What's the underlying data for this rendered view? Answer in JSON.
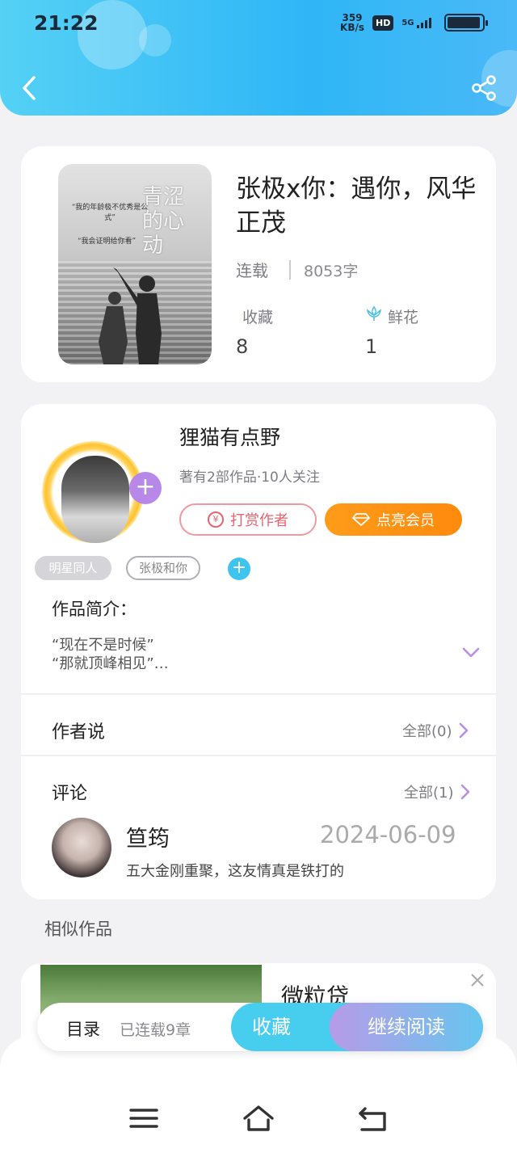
{
  "status_bar": {
    "time": "21:22",
    "net_speed_value": "359",
    "net_speed_unit": "KB/s",
    "hd": "HD",
    "signal": "5G",
    "battery_level": 0.95
  },
  "book": {
    "title": "张极x你：遇你，风华正茂",
    "status": "连载",
    "word_count": "8053字",
    "collect_label": "收藏",
    "collect_count": "8",
    "flower_label": "鲜花",
    "flower_count": "1",
    "cover_text": {
      "quote1": "“我的年龄极不优秀是公式”",
      "quote2": "“我会证明给你看”",
      "title": "青涩的心动"
    }
  },
  "author": {
    "name": "狸猫有点野",
    "meta": "著有2部作品·10人关注",
    "reward_label": "打赏作者",
    "vip_label": "点亮会员",
    "follow_label": "+"
  },
  "tags": [
    "明星同人",
    "张极和你"
  ],
  "intro": {
    "title": "作品简介：",
    "lines": [
      "“现在不是时候”",
      "“那就顶峰相见”…"
    ]
  },
  "author_says": {
    "title": "作者说",
    "link": "全部(0)"
  },
  "comments": {
    "title": "评论",
    "link": "全部(1)",
    "items": [
      {
        "name": "笪筠",
        "date": "2024-06-09",
        "text": "五大金刚重聚，这友情真是铁打的"
      }
    ]
  },
  "similar": {
    "title": "相似作品",
    "ad_title": "微粒贷"
  },
  "action_bar": {
    "toc_label": "目录",
    "toc_status": "已连载9章",
    "favorite_label": "收藏",
    "read_label": "继续阅读"
  },
  "colors": {
    "header_start": "#55d1f5",
    "header_end": "#2fb6f6",
    "accent_purple": "#b888e8",
    "accent_orange": "#ff8a0c",
    "accent_cyan": "#47cdee"
  }
}
